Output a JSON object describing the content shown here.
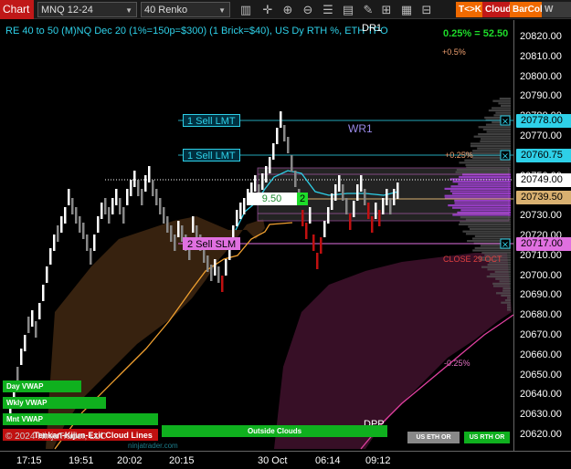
{
  "toolbar": {
    "app_label": "Chart",
    "instrument": "MNQ 12-24",
    "bar_type": "40 Renko",
    "icons": [
      "bar-chart-icon",
      "crosshair-icon",
      "zoom-in-icon",
      "zoom-out-icon",
      "properties-icon",
      "data-box-icon",
      "drawing-tools-icon",
      "strategy-icon",
      "indicator-icon",
      "template-icon"
    ],
    "buttons": [
      {
        "label": "T<>K",
        "color": "#f06a00"
      },
      {
        "label": "Cloud",
        "color": "#c01818"
      },
      {
        "label": "BarCol",
        "color": "#f06a00"
      },
      {
        "label": "W VWAP",
        "color": "#3a3a3a"
      }
    ]
  },
  "plot": {
    "title": "RE 40 to 50 (M)NQ Dec 20 (1%=150p=$300) (1 Brick=$40), US Dy RTH %, ETH TPO",
    "pct_change": "0.25% = 52.50",
    "annotations": {
      "dr1": "DR1",
      "wr1": "WR1",
      "plus_half": "+0.5%",
      "plus_quarter": "+0.25%",
      "minus_quarter": "-0.25%",
      "close": "CLOSE 29 OCT",
      "dpp": "DPP",
      "copyright": "© 2024 NinjaTrader, LLC",
      "ichimoku": "Tenkan-Kijun-Exit Cloud Lines",
      "watermark": "ninjatrader.com"
    },
    "trade_levels": [
      {
        "label": "1 Sell LMT",
        "price": 20778.0,
        "color": "#2ed0e8",
        "text_color": "#000"
      },
      {
        "label": "1 Sell LMT",
        "price": 20760.75,
        "color": "#2ed0e8",
        "text_color": "#000"
      },
      {
        "label": "2 Sell SLM",
        "price": 20717.0,
        "color": "#e070e0",
        "text_color": "#000"
      }
    ],
    "position": {
      "avg_price": "9.50",
      "quantity": "2"
    },
    "vwap_tags": [
      {
        "label": "Day VWAP"
      },
      {
        "label": "Wkly VWAP"
      },
      {
        "label": "Mnt VWAP"
      },
      {
        "label": "Outside Clouds"
      },
      {
        "label": "US ETH OR"
      },
      {
        "label": "US RTH OR"
      }
    ]
  },
  "price_axis": {
    "ticks": [
      "20820.00",
      "20810.00",
      "20800.00",
      "20790.00",
      "20780.00",
      "20770.00",
      "20760.00",
      "20750.00",
      "20740.00",
      "20730.00",
      "20720.00",
      "20710.00",
      "20700.00",
      "20690.00",
      "20680.00",
      "20670.00",
      "20660.00",
      "20650.00",
      "20640.00",
      "20630.00",
      "20620.00"
    ],
    "badges": [
      {
        "value": "20778.00",
        "bg": "#2ed0e8",
        "fg": "#000"
      },
      {
        "value": "20760.75",
        "bg": "#2ed0e8",
        "fg": "#000"
      },
      {
        "value": "20749.00",
        "bg": "#ffffff",
        "fg": "#000"
      },
      {
        "value": "20739.50",
        "bg": "#d8b070",
        "fg": "#000"
      },
      {
        "value": "20717.00",
        "bg": "#e070e0",
        "fg": "#000"
      }
    ]
  },
  "time_axis": {
    "ticks": [
      "17:15",
      "19:51",
      "20:02",
      "20:15",
      "30 Oct",
      "06:14",
      "09:12"
    ]
  }
}
